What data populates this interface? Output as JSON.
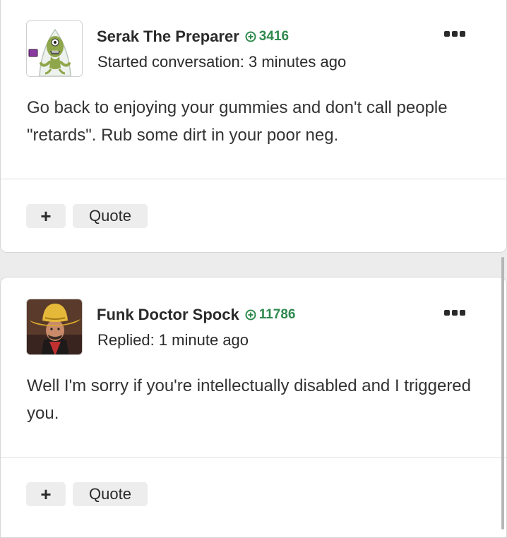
{
  "posts": [
    {
      "author": "Serak The Preparer",
      "reputation": "3416",
      "meta": "Started conversation: 3 minutes ago",
      "body": "Go back to enjoying your gummies and don't call people \"retards\". Rub some dirt in your poor neg.",
      "plus_label": "+",
      "quote_label": "Quote",
      "avatar_icon": "alien-avatar-icon"
    },
    {
      "author": "Funk Doctor Spock",
      "reputation": "11786",
      "meta": "Replied: 1 minute ago",
      "body": "Well I'm sorry if you're intellectually disabled and I triggered you.",
      "plus_label": "+",
      "quote_label": "Quote",
      "avatar_icon": "cowboy-hat-avatar-icon"
    }
  ],
  "colors": {
    "reputation": "#2f8a4e",
    "button_bg": "#ededed",
    "page_bg": "#ececec"
  }
}
